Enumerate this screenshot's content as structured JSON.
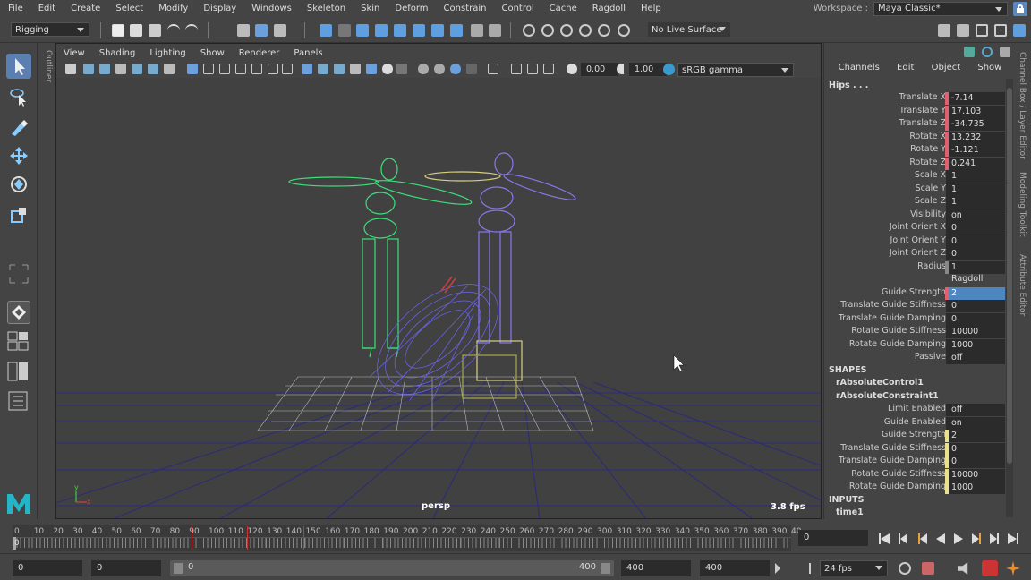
{
  "menubar": {
    "items": [
      "File",
      "Edit",
      "Create",
      "Select",
      "Modify",
      "Display",
      "Windows",
      "Skeleton",
      "Skin",
      "Deform",
      "Constrain",
      "Control",
      "Cache",
      "Ragdoll",
      "Help"
    ],
    "workspace_label": "Workspace :",
    "workspace_value": "Maya Classic*"
  },
  "shelf": {
    "mode": "Rigging",
    "live_surface": "No Live Surface"
  },
  "outliner_label": "Outliner",
  "viewport": {
    "menus": [
      "View",
      "Shading",
      "Lighting",
      "Show",
      "Renderer",
      "Panels"
    ],
    "exposure": "0.00",
    "gamma": "1.00",
    "color_space": "sRGB gamma",
    "camera": "persp",
    "fps": "3.8 fps"
  },
  "channelbox": {
    "menus": [
      "Channels",
      "Edit",
      "Object",
      "Show"
    ],
    "node": "Hips . . .",
    "attrs": [
      {
        "k": "Translate X",
        "v": "-7.14",
        "m": "#e06070"
      },
      {
        "k": "Translate Y",
        "v": "17.103",
        "m": "#e06070"
      },
      {
        "k": "Translate Z",
        "v": "-34.735",
        "m": "#e06070"
      },
      {
        "k": "Rotate X",
        "v": "13.232",
        "m": "#e06070"
      },
      {
        "k": "Rotate Y",
        "v": "-1.121",
        "m": "#e06070"
      },
      {
        "k": "Rotate Z",
        "v": "0.241",
        "m": "#e06070"
      },
      {
        "k": "Scale X",
        "v": "1",
        "m": ""
      },
      {
        "k": "Scale Y",
        "v": "1",
        "m": ""
      },
      {
        "k": "Scale Z",
        "v": "1",
        "m": ""
      },
      {
        "k": "Visibility",
        "v": "on",
        "m": ""
      },
      {
        "k": "Joint Orient X",
        "v": "0",
        "m": ""
      },
      {
        "k": "Joint Orient Y",
        "v": "0",
        "m": ""
      },
      {
        "k": "Joint Orient Z",
        "v": "0",
        "m": ""
      },
      {
        "k": "Radius",
        "v": "1",
        "m": "#888"
      }
    ],
    "ragdoll_label": "Ragdoll",
    "ragdoll": [
      {
        "k": "Guide Strength",
        "v": "2",
        "m": "#e06070",
        "sel": true
      },
      {
        "k": "Translate Guide Stiffness",
        "v": "0",
        "m": ""
      },
      {
        "k": "Translate Guide Damping",
        "v": "0",
        "m": ""
      },
      {
        "k": "Rotate Guide Stiffness",
        "v": "10000",
        "m": ""
      },
      {
        "k": "Rotate Guide Damping",
        "v": "1000",
        "m": ""
      },
      {
        "k": "Passive",
        "v": "off",
        "m": ""
      }
    ],
    "shapes_label": "SHAPES",
    "shape1": "rAbsoluteControl1",
    "shape2": "rAbsoluteConstraint1",
    "shape_attrs": [
      {
        "k": "Limit Enabled",
        "v": "off",
        "m": ""
      },
      {
        "k": "Guide Enabled",
        "v": "on",
        "m": ""
      },
      {
        "k": "Guide Strength",
        "v": "2",
        "m": "#e8e08a"
      },
      {
        "k": "Translate Guide Stiffness",
        "v": "0",
        "m": "#e8e08a"
      },
      {
        "k": "Translate Guide Damping",
        "v": "0",
        "m": "#e8e08a"
      },
      {
        "k": "Rotate Guide Stiffness",
        "v": "10000",
        "m": "#e8e08a"
      },
      {
        "k": "Rotate Guide Damping",
        "v": "1000",
        "m": "#e8e08a"
      }
    ],
    "inputs_label": "INPUTS",
    "input1": "time1"
  },
  "sidetabs": [
    "Channel Box / Layer Editor",
    "Modeling Toolkit",
    "Attribute Editor"
  ],
  "timeline": {
    "ticks": [
      "0",
      "10",
      "20",
      "30",
      "40",
      "50",
      "60",
      "70",
      "80",
      "90",
      "100",
      "110",
      "120",
      "130",
      "140",
      "150",
      "160",
      "170",
      "180",
      "190",
      "200",
      "210",
      "220",
      "230",
      "240",
      "250",
      "260",
      "270",
      "280",
      "290",
      "300",
      "310",
      "320",
      "330",
      "340",
      "350",
      "360",
      "370",
      "380",
      "390",
      "40"
    ],
    "current": "0",
    "current_field": "0"
  },
  "range": {
    "start": "0",
    "start2": "0",
    "slider_start": "0",
    "slider_end": "400",
    "end": "400",
    "end2": "400",
    "fps": "24 fps"
  }
}
